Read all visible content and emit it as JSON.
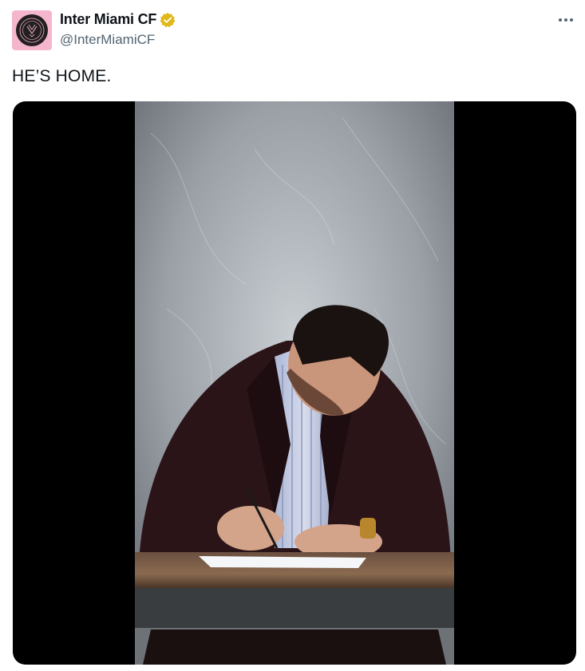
{
  "tweet": {
    "display_name": "Inter Miami CF",
    "handle": "@InterMiamiCF",
    "text": "HE’S HOME.",
    "verified_icon": "verified-badge-icon",
    "more_icon": "more-options-icon"
  },
  "colors": {
    "avatar_bg": "#f5b6cd",
    "verified_gold": "#e2b719",
    "handle_gray": "#536471",
    "media_bg": "#000000"
  }
}
